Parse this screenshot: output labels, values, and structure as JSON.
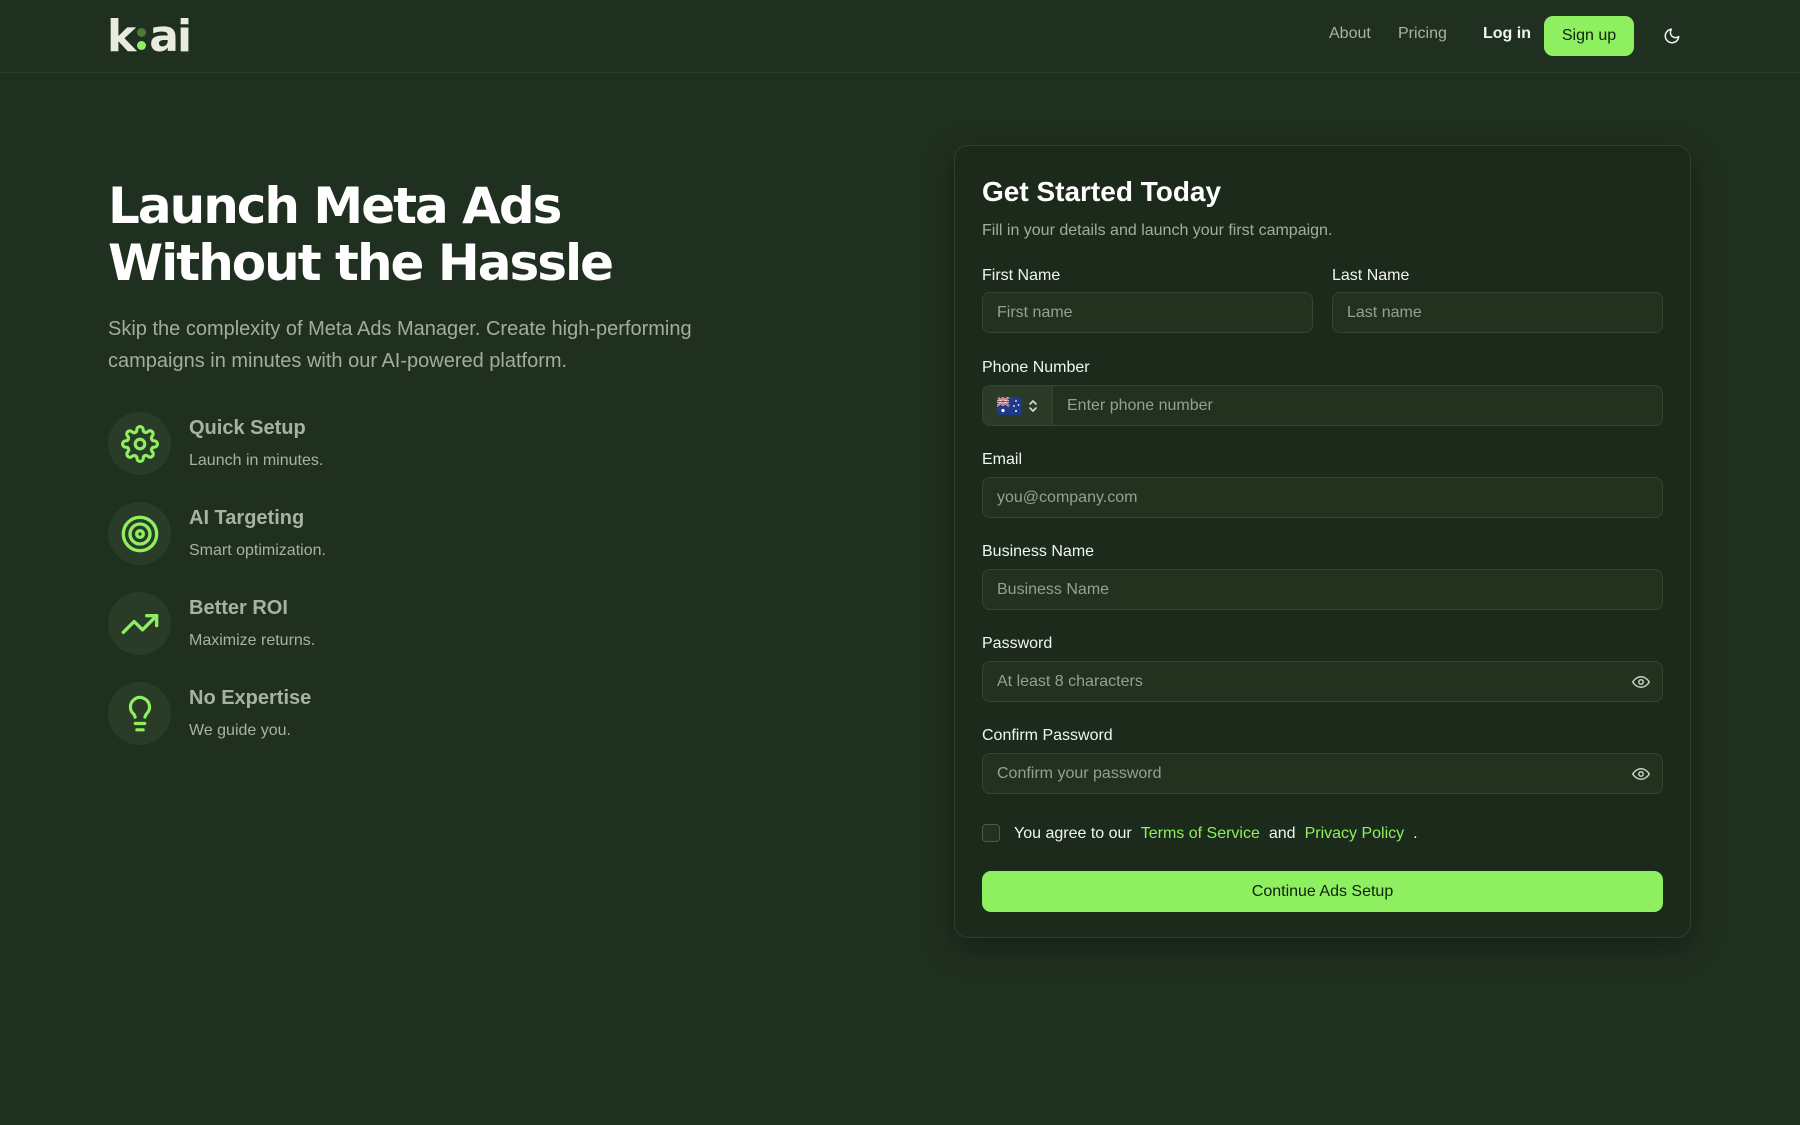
{
  "header": {
    "logo": {
      "left": "k",
      "right": "ai"
    },
    "nav": {
      "about": "About",
      "pricing": "Pricing"
    },
    "login": "Log in",
    "signup": "Sign up",
    "theme_icon": "moon-icon"
  },
  "hero": {
    "title_line1": "Launch Meta Ads",
    "title_line2": "Without the Hassle",
    "subtitle": "Skip the complexity of Meta Ads Manager. Create high-performing campaigns in minutes with our AI-powered platform.",
    "features": [
      {
        "icon": "gear-icon",
        "title": "Quick Setup",
        "desc": "Launch in minutes."
      },
      {
        "icon": "target-icon",
        "title": "AI Targeting",
        "desc": "Smart optimization."
      },
      {
        "icon": "trending-up-icon",
        "title": "Better ROI",
        "desc": "Maximize returns."
      },
      {
        "icon": "lightbulb-icon",
        "title": "No Expertise",
        "desc": "We guide you."
      }
    ]
  },
  "form": {
    "title": "Get Started Today",
    "subtitle": "Fill in your details and launch your first campaign.",
    "first_name": {
      "label": "First Name",
      "placeholder": "First name"
    },
    "last_name": {
      "label": "Last Name",
      "placeholder": "Last name"
    },
    "phone": {
      "label": "Phone Number",
      "placeholder": "Enter phone number",
      "country_icon": "australia-flag-icon"
    },
    "email": {
      "label": "Email",
      "placeholder": "you@company.com"
    },
    "business": {
      "label": "Business Name",
      "placeholder": "Business Name"
    },
    "password": {
      "label": "Password",
      "placeholder": "At least 8 characters"
    },
    "confirm_password": {
      "label": "Confirm Password",
      "placeholder": "Confirm your password"
    },
    "agree": {
      "prefix": "You agree to our",
      "terms": "Terms of Service",
      "and": "and",
      "privacy": "Privacy Policy",
      "suffix": "."
    },
    "submit": "Continue Ads Setup"
  },
  "colors": {
    "background": "#203020",
    "accent": "#8ef060",
    "card": "#1c2a1b"
  }
}
